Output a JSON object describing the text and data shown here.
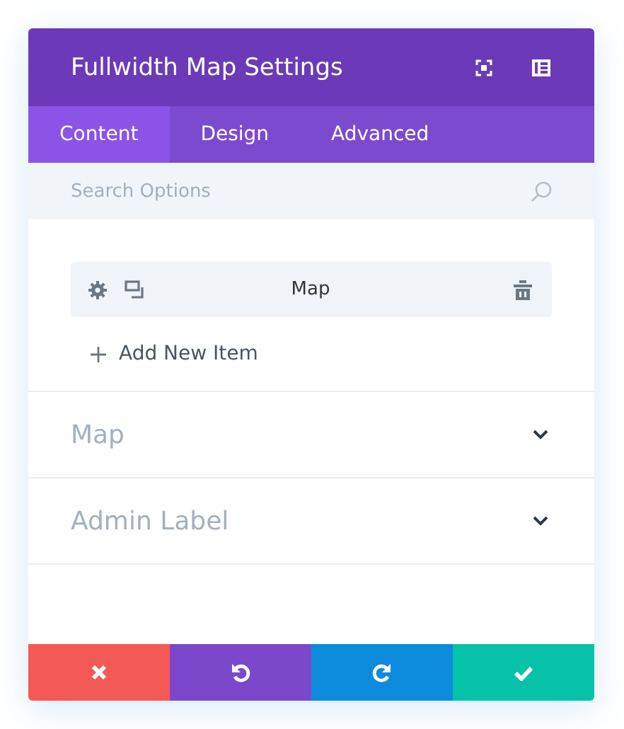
{
  "window": {
    "title": "Fullwidth Map Settings"
  },
  "tabs": [
    {
      "label": "Content",
      "selected": true
    },
    {
      "label": "Design",
      "selected": false
    },
    {
      "label": "Advanced",
      "selected": false
    }
  ],
  "search": {
    "placeholder": "Search Options"
  },
  "items": [
    {
      "label": "Map"
    }
  ],
  "add_item": {
    "label": "Add New Item"
  },
  "sections": [
    {
      "title": "Map",
      "expanded": false
    },
    {
      "title": "Admin Label",
      "expanded": false
    }
  ],
  "footer_buttons": [
    {
      "kind": "cancel"
    },
    {
      "kind": "undo"
    },
    {
      "kind": "redo"
    },
    {
      "kind": "save"
    }
  ]
}
